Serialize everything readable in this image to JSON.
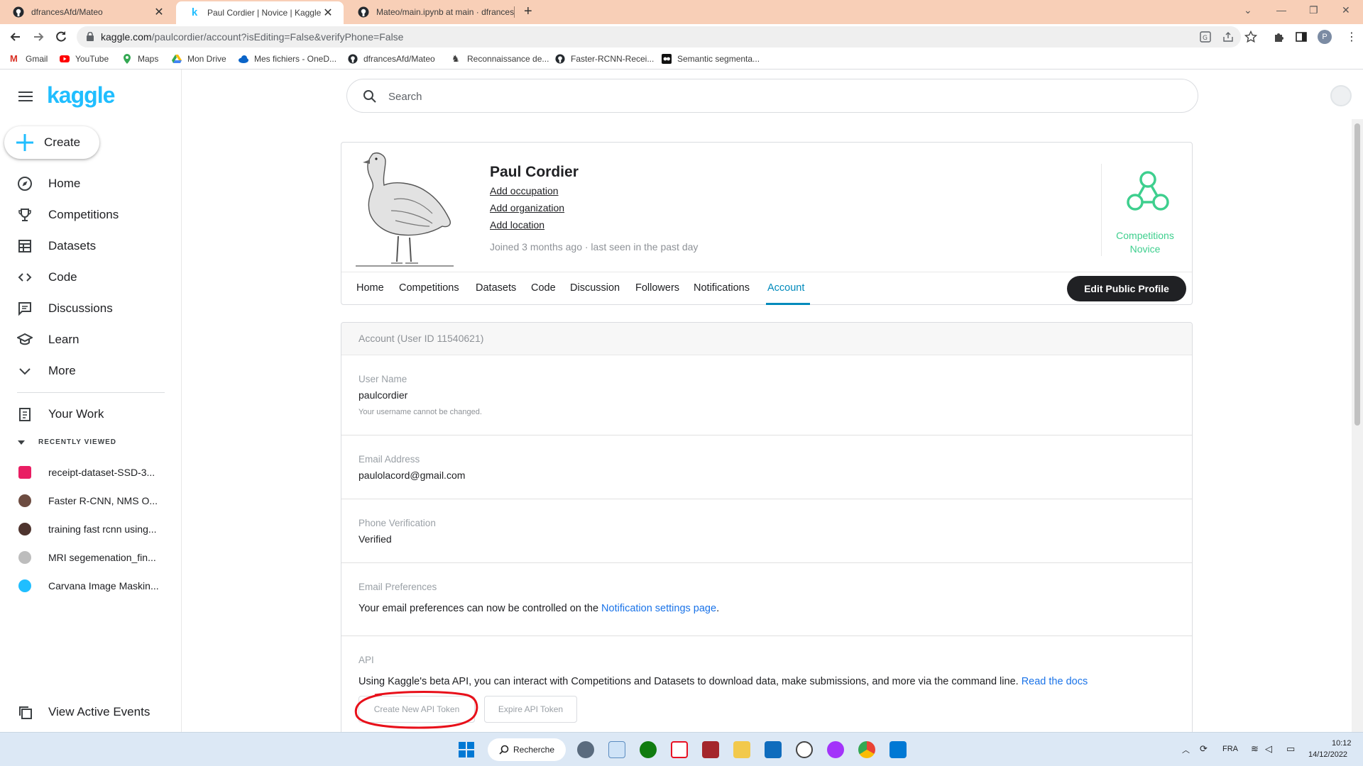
{
  "browser": {
    "tabs": [
      {
        "title": "dfrancesAfd/Mateo",
        "icon": "github-icon",
        "active": false
      },
      {
        "title": "Paul Cordier | Novice | Kaggle",
        "icon": "kaggle-icon",
        "active": true
      },
      {
        "title": "Mateo/main.ipynb at main · dfrancesAfd",
        "icon": "github-icon",
        "active": false
      }
    ],
    "new_tab_label": "+",
    "url_host": "kaggle.com",
    "url_path": "/paulcordier/account?isEditing=False&verifyPhone=False",
    "profile_initial": "P",
    "bookmarks": [
      {
        "label": "Gmail",
        "icon": "gmail-icon"
      },
      {
        "label": "YouTube",
        "icon": "youtube-icon"
      },
      {
        "label": "Maps",
        "icon": "maps-icon"
      },
      {
        "label": "Mon Drive",
        "icon": "drive-icon"
      },
      {
        "label": "Mes fichiers - OneD...",
        "icon": "onedrive-icon"
      },
      {
        "label": "dfrancesAfd/Mateo",
        "icon": "github-icon"
      },
      {
        "label": "Reconnaissance de...",
        "icon": "bookmark-icon"
      },
      {
        "label": "Faster-RCNN-Recei...",
        "icon": "github-icon"
      },
      {
        "label": "Semantic segmenta...",
        "icon": "bookmark-icon"
      }
    ]
  },
  "sidebar": {
    "logo": "kaggle",
    "create_label": "Create",
    "items": [
      {
        "label": "Home",
        "icon": "compass-icon"
      },
      {
        "label": "Competitions",
        "icon": "trophy-icon"
      },
      {
        "label": "Datasets",
        "icon": "table-icon"
      },
      {
        "label": "Code",
        "icon": "code-icon"
      },
      {
        "label": "Discussions",
        "icon": "discussion-icon"
      },
      {
        "label": "Learn",
        "icon": "school-icon"
      },
      {
        "label": "More",
        "icon": "chevron-down-icon"
      }
    ],
    "your_work": "Your Work",
    "recently_viewed_title": "RECENTLY VIEWED",
    "recent": [
      {
        "label": "receipt-dataset-SSD-3...",
        "color": "#e91e63"
      },
      {
        "label": "Faster R-CNN, NMS O...",
        "color": "#6d4c41"
      },
      {
        "label": "training fast rcnn using...",
        "color": "#4e342e"
      },
      {
        "label": "MRI segemenation_fin...",
        "color": "#9e9e9e"
      },
      {
        "label": "Carvana Image Maskin...",
        "color": "#20beff"
      }
    ],
    "view_events": "View Active Events"
  },
  "search": {
    "placeholder": "Search"
  },
  "profile": {
    "name": "Paul Cordier",
    "links": [
      "Add occupation",
      "Add organization",
      "Add location"
    ],
    "joined": "Joined 3 months ago · last seen in the past day",
    "tier_line1": "Competitions",
    "tier_line2": "Novice",
    "tabs": [
      "Home",
      "Competitions",
      "Datasets",
      "Code",
      "Discussion",
      "Followers",
      "Notifications",
      "Account"
    ],
    "active_tab": "Account",
    "edit_button": "Edit Public Profile"
  },
  "account": {
    "header": "Account (User ID 11540621)",
    "username_label": "User Name",
    "username": "paulcordier",
    "username_note": "Your username cannot be changed.",
    "email_label": "Email Address",
    "email": "paulolacord@gmail.com",
    "phone_label": "Phone Verification",
    "phone_status": "Verified",
    "email_prefs_label": "Email Preferences",
    "email_prefs_text": "Your email preferences can now be controlled on the",
    "email_prefs_link": "Notification settings page",
    "email_prefs_end": ".",
    "api_label": "API",
    "api_text": "Using Kaggle's beta API, you can interact with Competitions and Datasets to download data, make submissions, and more via the command line.",
    "api_link": "Read the docs",
    "create_token": "Create New API Token",
    "expire_token": "Expire API Token"
  },
  "taskbar": {
    "search_label": "Recherche",
    "lang": "FRA",
    "time": "10:12",
    "date": "14/12/2022"
  },
  "colors": {
    "kaggle_blue": "#20beff",
    "link_blue": "#008abc",
    "novice_green": "#3ecf8e",
    "tab_strip": "#f8cfb7",
    "highlight_red": "#e8101a"
  }
}
